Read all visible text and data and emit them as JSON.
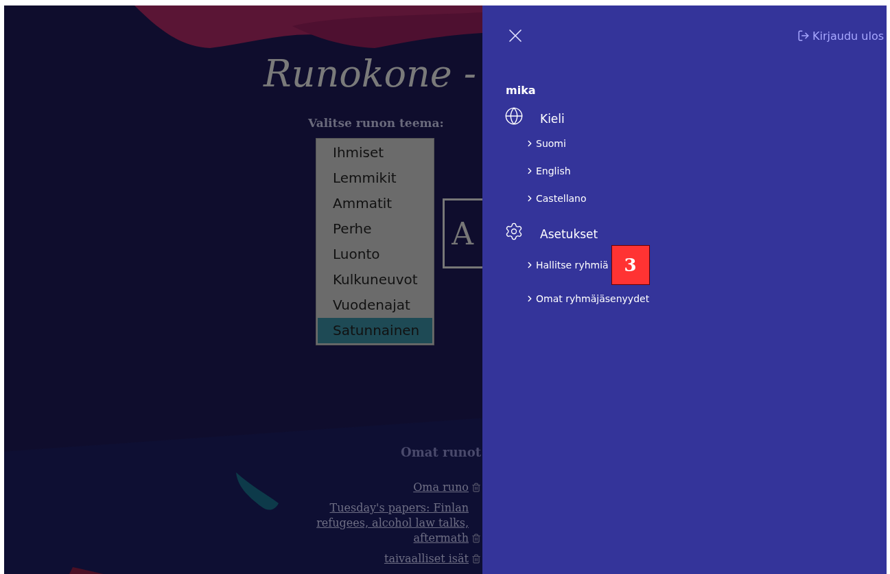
{
  "page": {
    "title": "Runokone -",
    "theme_label": "Valitse runon teema:",
    "themes": [
      {
        "label": "Ihmiset",
        "selected": false
      },
      {
        "label": "Lemmikit",
        "selected": false
      },
      {
        "label": "Ammatit",
        "selected": false
      },
      {
        "label": "Perhe",
        "selected": false
      },
      {
        "label": "Luonto",
        "selected": false
      },
      {
        "label": "Kulkuneuvot",
        "selected": false
      },
      {
        "label": "Vuodenajat",
        "selected": false
      },
      {
        "label": "Satunnainen",
        "selected": true
      }
    ],
    "preview_letter": "A",
    "poems_heading": "Omat runot",
    "poems": [
      {
        "lines": [
          "Oma runo"
        ]
      },
      {
        "lines": [
          "Tuesday's papers: Finlan",
          "refugees, alcohol law talks,",
          "aftermath"
        ]
      },
      {
        "lines": [
          "taivaalliset isät"
        ]
      }
    ]
  },
  "panel": {
    "logout": "Kirjaudu ulos",
    "user": "mika",
    "sections": [
      {
        "kind": "language",
        "title": "Kieli",
        "items": [
          "Suomi",
          "English",
          "Castellano"
        ]
      },
      {
        "kind": "settings",
        "title": "Asetukset",
        "items": [
          "Hallitse ryhmiä",
          "Omat ryhmäjäsenyydet"
        ]
      }
    ],
    "badge": "3"
  }
}
